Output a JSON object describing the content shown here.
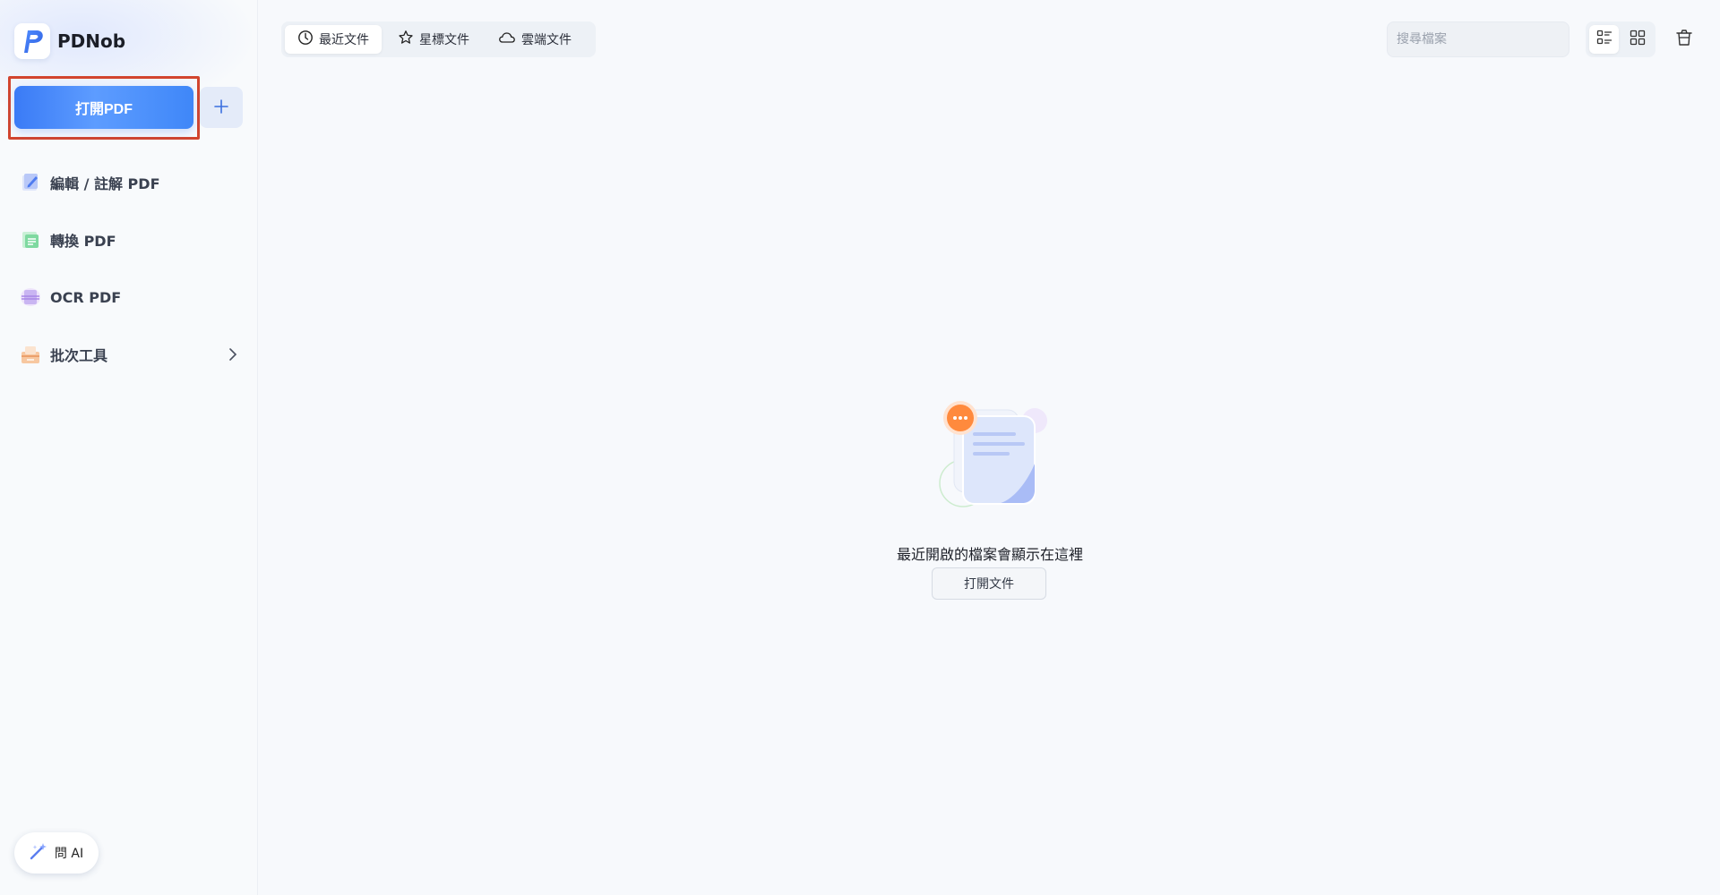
{
  "brand": {
    "name": "PDNob"
  },
  "sidebar": {
    "open_pdf_label": "打開PDF",
    "add_icon": "plus-icon",
    "items": [
      {
        "label": "編輯 / 註解 PDF",
        "icon": "edit-pdf-icon"
      },
      {
        "label": "轉換 PDF",
        "icon": "convert-pdf-icon"
      },
      {
        "label": "OCR PDF",
        "icon": "ocr-pdf-icon"
      },
      {
        "label": "批次工具",
        "icon": "batch-tools-icon"
      }
    ],
    "ask_ai_label": "問 AI"
  },
  "tabs": [
    {
      "label": "最近文件",
      "icon": "clock-icon",
      "active": true
    },
    {
      "label": "星標文件",
      "icon": "star-icon",
      "active": false
    },
    {
      "label": "雲端文件",
      "icon": "cloud-icon",
      "active": false
    }
  ],
  "search": {
    "placeholder": "搜尋檔案",
    "value": ""
  },
  "view": {
    "mode": "list"
  },
  "empty_state": {
    "message": "最近開啟的檔案會顯示在這裡",
    "button_label": "打開文件"
  },
  "colors": {
    "accent": "#3a7bf6",
    "highlight_border": "#d2452e",
    "badge_orange": "#ff8a3d"
  }
}
